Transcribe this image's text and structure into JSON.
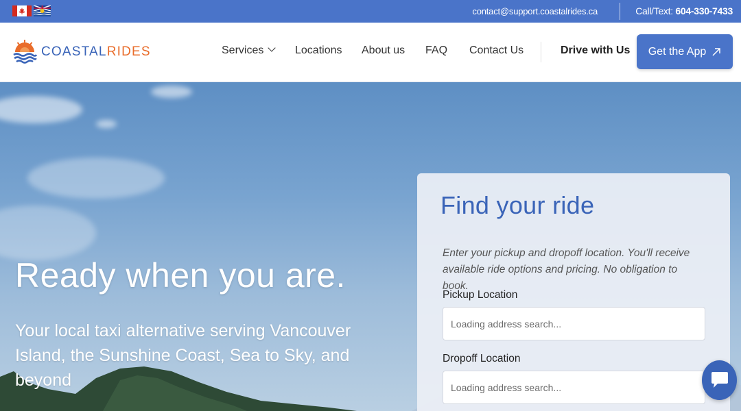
{
  "topbar": {
    "email": "contact@support.coastalrides.ca",
    "phone_label": "Call/Text:",
    "phone_number": "604-330-7433",
    "flags": [
      "canada-flag-icon",
      "bc-flag-icon"
    ]
  },
  "logo": {
    "part1": "COASTAL",
    "part2": "RIDES",
    "icon": "sun-waves-logo-icon"
  },
  "nav": {
    "services": "Services",
    "locations": "Locations",
    "about": "About us",
    "faq": "FAQ",
    "contact": "Contact Us",
    "drive": "Drive with Us",
    "app_button": "Get the App"
  },
  "hero": {
    "title": "Ready when you are.",
    "subtitle": "Your local taxi alternative serving Vancouver Island, the Sunshine Coast, Sea to Sky, and beyond"
  },
  "ride_form": {
    "title": "Find your ride",
    "description": "Enter your pickup and dropoff location. You'll receive available ride options and pricing. No obligation to book.",
    "pickup_label": "Pickup Location",
    "pickup_placeholder": "Loading address search...",
    "dropoff_label": "Dropoff Location",
    "dropoff_placeholder": "Loading address search..."
  },
  "chat": {
    "icon": "chat-bubble-icon"
  },
  "colors": {
    "brand_blue": "#4a74c9",
    "brand_orange": "#e96c2a",
    "heading_blue": "#3a64b8"
  }
}
